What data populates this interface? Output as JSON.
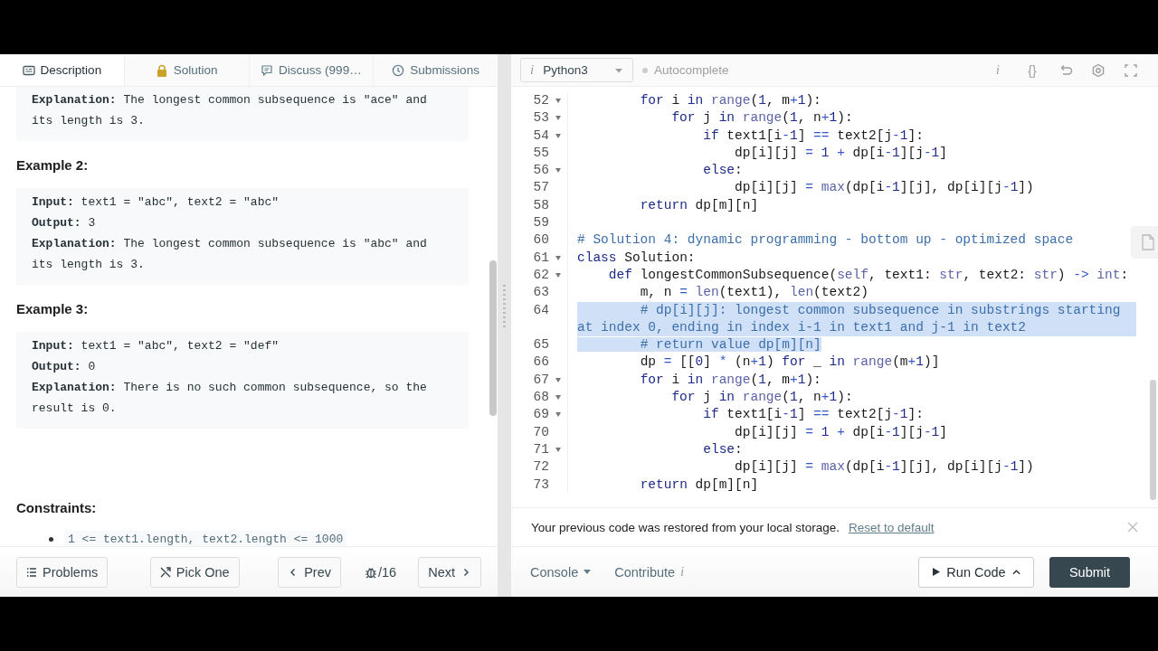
{
  "problem_tabs": [
    {
      "label": "Description",
      "selected": true
    },
    {
      "label": "Solution",
      "selected": false
    },
    {
      "label": "Discuss (999…",
      "selected": false
    },
    {
      "label": "Submissions",
      "selected": false
    }
  ],
  "description": {
    "blocks": [
      {
        "kind": "example",
        "lines": [
          "**Explanation:** The longest common subsequence is \"ace\" and its length is 3."
        ]
      },
      {
        "kind": "heading",
        "text": "Example 2:"
      },
      {
        "kind": "example",
        "lines": [
          "**Input:** text1 = \"abc\", text2 = \"abc\"",
          "**Output:** 3",
          "**Explanation:** The longest common subsequence is \"abc\" and its length is 3."
        ]
      },
      {
        "kind": "heading",
        "text": "Example 3:"
      },
      {
        "kind": "example",
        "lines": [
          "**Input:** text1 = \"abc\", text2 = \"def\"",
          "**Output:** 0",
          "**Explanation:** There is no such common subsequence, so the result is 0."
        ]
      },
      {
        "kind": "heading",
        "text": "Constraints:"
      },
      {
        "kind": "list",
        "items": [
          "1 <= text1.length, text2.length <= 1000"
        ]
      }
    ]
  },
  "problem_nav": {
    "problems": "Problems",
    "pick_one": "Pick One",
    "prev": "Prev",
    "counter": "/16",
    "next": "Next"
  },
  "editor": {
    "language_mark": "i",
    "language": "Python3",
    "autocomplete": "Autocomplete",
    "tool_glyphs": [
      "i",
      "{}"
    ],
    "lines": [
      {
        "number": "52",
        "fold": true,
        "selected": false,
        "tokens": [
          {
            "kind": "keyword",
            "text": "        for"
          },
          {
            "kind": "text",
            "text": " i "
          },
          {
            "kind": "keyword",
            "text": "in"
          },
          {
            "kind": "builtin",
            "text": " range"
          },
          {
            "kind": "text",
            "text": "("
          },
          {
            "kind": "number",
            "text": "1"
          },
          {
            "kind": "text",
            "text": ", m"
          },
          {
            "kind": "operator",
            "text": "+"
          },
          {
            "kind": "number",
            "text": "1"
          },
          {
            "kind": "text",
            "text": "):"
          }
        ]
      },
      {
        "number": "53",
        "fold": true,
        "selected": false,
        "tokens": [
          {
            "kind": "keyword",
            "text": "            for"
          },
          {
            "kind": "text",
            "text": " j "
          },
          {
            "kind": "keyword",
            "text": "in"
          },
          {
            "kind": "builtin",
            "text": " range"
          },
          {
            "kind": "text",
            "text": "("
          },
          {
            "kind": "number",
            "text": "1"
          },
          {
            "kind": "text",
            "text": ", n"
          },
          {
            "kind": "operator",
            "text": "+"
          },
          {
            "kind": "number",
            "text": "1"
          },
          {
            "kind": "text",
            "text": "):"
          }
        ]
      },
      {
        "number": "54",
        "fold": true,
        "selected": false,
        "tokens": [
          {
            "kind": "keyword",
            "text": "                if"
          },
          {
            "kind": "text",
            "text": " text1[i"
          },
          {
            "kind": "operator",
            "text": "-"
          },
          {
            "kind": "number",
            "text": "1"
          },
          {
            "kind": "text",
            "text": "]"
          },
          {
            "kind": "operator",
            "text": " =="
          },
          {
            "kind": "text",
            "text": " text2[j"
          },
          {
            "kind": "operator",
            "text": "-"
          },
          {
            "kind": "number",
            "text": "1"
          },
          {
            "kind": "text",
            "text": "]:"
          }
        ]
      },
      {
        "number": "55",
        "fold": false,
        "selected": false,
        "tokens": [
          {
            "kind": "text",
            "text": "                    dp[i][j]"
          },
          {
            "kind": "operator",
            "text": " ="
          },
          {
            "kind": "number",
            "text": " 1"
          },
          {
            "kind": "operator",
            "text": " +"
          },
          {
            "kind": "text",
            "text": " dp[i"
          },
          {
            "kind": "operator",
            "text": "-"
          },
          {
            "kind": "number",
            "text": "1"
          },
          {
            "kind": "text",
            "text": "][j"
          },
          {
            "kind": "operator",
            "text": "-"
          },
          {
            "kind": "number",
            "text": "1"
          },
          {
            "kind": "text",
            "text": "]"
          }
        ]
      },
      {
        "number": "56",
        "fold": true,
        "selected": false,
        "tokens": [
          {
            "kind": "keyword",
            "text": "                else"
          },
          {
            "kind": "text",
            "text": ":"
          }
        ]
      },
      {
        "number": "57",
        "fold": false,
        "selected": false,
        "tokens": [
          {
            "kind": "text",
            "text": "                    dp[i][j]"
          },
          {
            "kind": "operator",
            "text": " ="
          },
          {
            "kind": "builtin",
            "text": " max"
          },
          {
            "kind": "text",
            "text": "(dp[i"
          },
          {
            "kind": "operator",
            "text": "-"
          },
          {
            "kind": "number",
            "text": "1"
          },
          {
            "kind": "text",
            "text": "][j], dp[i][j"
          },
          {
            "kind": "operator",
            "text": "-"
          },
          {
            "kind": "number",
            "text": "1"
          },
          {
            "kind": "text",
            "text": "])"
          }
        ]
      },
      {
        "number": "58",
        "fold": false,
        "selected": false,
        "tokens": [
          {
            "kind": "keyword",
            "text": "        return"
          },
          {
            "kind": "text",
            "text": " dp[m][n]"
          }
        ]
      },
      {
        "number": "59",
        "fold": false,
        "selected": false
      },
      {
        "number": "60",
        "fold": false,
        "selected": false,
        "tokens": [
          {
            "kind": "comment",
            "text": "# Solution 4: dynamic programming - bottom up - optimized space"
          }
        ]
      },
      {
        "number": "61",
        "fold": true,
        "selected": false,
        "tokens": [
          {
            "kind": "keyword",
            "text": "class"
          },
          {
            "kind": "text",
            "text": " Solution:"
          }
        ]
      },
      {
        "number": "62",
        "fold": true,
        "selected": false,
        "tokens": [
          {
            "kind": "keyword",
            "text": "    def"
          },
          {
            "kind": "text",
            "text": " longestCommonSubsequence("
          },
          {
            "kind": "builtin",
            "text": "self"
          },
          {
            "kind": "text",
            "text": ", text1: "
          },
          {
            "kind": "builtin",
            "text": "str"
          },
          {
            "kind": "text",
            "text": ", text2: "
          },
          {
            "kind": "builtin",
            "text": "str"
          },
          {
            "kind": "text",
            "text": ")"
          },
          {
            "kind": "operator",
            "text": " ->"
          },
          {
            "kind": "builtin",
            "text": " int"
          },
          {
            "kind": "text",
            "text": ":"
          }
        ]
      },
      {
        "number": "63",
        "fold": false,
        "selected": false,
        "tokens": [
          {
            "kind": "text",
            "text": "        m, n"
          },
          {
            "kind": "operator",
            "text": " ="
          },
          {
            "kind": "builtin",
            "text": " len"
          },
          {
            "kind": "text",
            "text": "(text1), "
          },
          {
            "kind": "builtin",
            "text": "len"
          },
          {
            "kind": "text",
            "text": "(text2)"
          }
        ]
      },
      {
        "number": "64",
        "fold": false,
        "selected": true,
        "tokens": [
          {
            "kind": "comment",
            "text": "        # dp[i][j]: longest common subsequence in substrings starting at index 0, ending in index i-1 in text1 and j-1 in text2"
          }
        ]
      },
      {
        "number": "65",
        "fold": false,
        "selected": true,
        "tokens": [
          {
            "kind": "comment",
            "text": "        # return value dp[m][n]"
          }
        ]
      },
      {
        "number": "66",
        "fold": false,
        "selected": false,
        "tokens": [
          {
            "kind": "text",
            "text": "        dp"
          },
          {
            "kind": "operator",
            "text": " ="
          },
          {
            "kind": "text",
            "text": " [["
          },
          {
            "kind": "number",
            "text": "0"
          },
          {
            "kind": "text",
            "text": "]"
          },
          {
            "kind": "operator",
            "text": " *"
          },
          {
            "kind": "text",
            "text": " (n"
          },
          {
            "kind": "operator",
            "text": "+"
          },
          {
            "kind": "number",
            "text": "1"
          },
          {
            "kind": "text",
            "text": ")"
          },
          {
            "kind": "keyword",
            "text": " for"
          },
          {
            "kind": "text",
            "text": " _ "
          },
          {
            "kind": "keyword",
            "text": "in"
          },
          {
            "kind": "builtin",
            "text": " range"
          },
          {
            "kind": "text",
            "text": "(m"
          },
          {
            "kind": "operator",
            "text": "+"
          },
          {
            "kind": "number",
            "text": "1"
          },
          {
            "kind": "text",
            "text": ")]"
          }
        ]
      },
      {
        "number": "67",
        "fold": true,
        "selected": false,
        "tokens": [
          {
            "kind": "keyword",
            "text": "        for"
          },
          {
            "kind": "text",
            "text": " i "
          },
          {
            "kind": "keyword",
            "text": "in"
          },
          {
            "kind": "builtin",
            "text": " range"
          },
          {
            "kind": "text",
            "text": "("
          },
          {
            "kind": "number",
            "text": "1"
          },
          {
            "kind": "text",
            "text": ", m"
          },
          {
            "kind": "operator",
            "text": "+"
          },
          {
            "kind": "number",
            "text": "1"
          },
          {
            "kind": "text",
            "text": "):"
          }
        ]
      },
      {
        "number": "68",
        "fold": true,
        "selected": false,
        "tokens": [
          {
            "kind": "keyword",
            "text": "            for"
          },
          {
            "kind": "text",
            "text": " j "
          },
          {
            "kind": "keyword",
            "text": "in"
          },
          {
            "kind": "builtin",
            "text": " range"
          },
          {
            "kind": "text",
            "text": "("
          },
          {
            "kind": "number",
            "text": "1"
          },
          {
            "kind": "text",
            "text": ", n"
          },
          {
            "kind": "operator",
            "text": "+"
          },
          {
            "kind": "number",
            "text": "1"
          },
          {
            "kind": "text",
            "text": "):"
          }
        ]
      },
      {
        "number": "69",
        "fold": true,
        "selected": false,
        "tokens": [
          {
            "kind": "keyword",
            "text": "                if"
          },
          {
            "kind": "text",
            "text": " text1[i"
          },
          {
            "kind": "operator",
            "text": "-"
          },
          {
            "kind": "number",
            "text": "1"
          },
          {
            "kind": "text",
            "text": "]"
          },
          {
            "kind": "operator",
            "text": " =="
          },
          {
            "kind": "text",
            "text": " text2[j"
          },
          {
            "kind": "operator",
            "text": "-"
          },
          {
            "kind": "number",
            "text": "1"
          },
          {
            "kind": "text",
            "text": "]:"
          }
        ]
      },
      {
        "number": "70",
        "fold": false,
        "selected": false,
        "tokens": [
          {
            "kind": "text",
            "text": "                    dp[i][j]"
          },
          {
            "kind": "operator",
            "text": " ="
          },
          {
            "kind": "number",
            "text": " 1"
          },
          {
            "kind": "operator",
            "text": " +"
          },
          {
            "kind": "text",
            "text": " dp[i"
          },
          {
            "kind": "operator",
            "text": "-"
          },
          {
            "kind": "number",
            "text": "1"
          },
          {
            "kind": "text",
            "text": "][j"
          },
          {
            "kind": "operator",
            "text": "-"
          },
          {
            "kind": "number",
            "text": "1"
          },
          {
            "kind": "text",
            "text": "]"
          }
        ]
      },
      {
        "number": "71",
        "fold": true,
        "selected": false,
        "tokens": [
          {
            "kind": "keyword",
            "text": "                else"
          },
          {
            "kind": "text",
            "text": ":"
          }
        ]
      },
      {
        "number": "72",
        "fold": false,
        "selected": false,
        "tokens": [
          {
            "kind": "text",
            "text": "                    dp[i][j]"
          },
          {
            "kind": "operator",
            "text": " ="
          },
          {
            "kind": "builtin",
            "text": " max"
          },
          {
            "kind": "text",
            "text": "(dp[i"
          },
          {
            "kind": "operator",
            "text": "-"
          },
          {
            "kind": "number",
            "text": "1"
          },
          {
            "kind": "text",
            "text": "][j], dp[i][j"
          },
          {
            "kind": "operator",
            "text": "-"
          },
          {
            "kind": "number",
            "text": "1"
          },
          {
            "kind": "text",
            "text": "])"
          }
        ]
      },
      {
        "number": "73",
        "fold": false,
        "selected": false,
        "tokens": [
          {
            "kind": "keyword",
            "text": "        return"
          },
          {
            "kind": "text",
            "text": " dp[m][n]"
          }
        ]
      }
    ]
  },
  "notice": {
    "text": "Your previous code was restored from your local storage.",
    "link": "Reset to default"
  },
  "footer": {
    "console": "Console",
    "contribute": "Contribute",
    "contribute_mark": "i",
    "run": "Run Code",
    "submit": "Submit"
  }
}
